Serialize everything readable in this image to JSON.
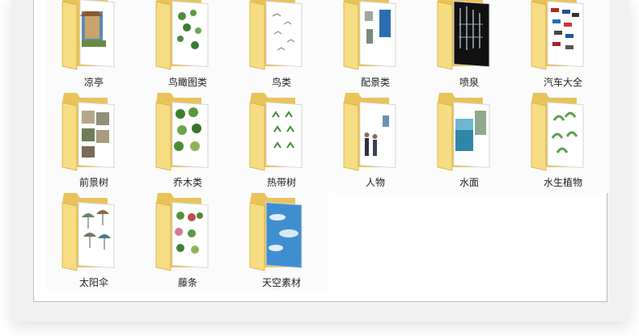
{
  "folders": {
    "row1": [
      "凉亭",
      "鸟瞰图类",
      "鸟类",
      "配景类",
      "喷泉",
      "汽车大全"
    ],
    "row2": [
      "前景树",
      "乔木类",
      "热带树",
      "人物",
      "水面",
      "水生植物"
    ],
    "row3": [
      "太阳伞",
      "藤条",
      "天空素材"
    ]
  },
  "colors": {
    "folder_back": "#e9c35a",
    "folder_front": "#f6dc82",
    "folder_edge": "#d8ad3c",
    "selection_bg": "#fbfbfb",
    "window_border": "#bcbcbc"
  },
  "icons": [
    "folder-icon"
  ]
}
